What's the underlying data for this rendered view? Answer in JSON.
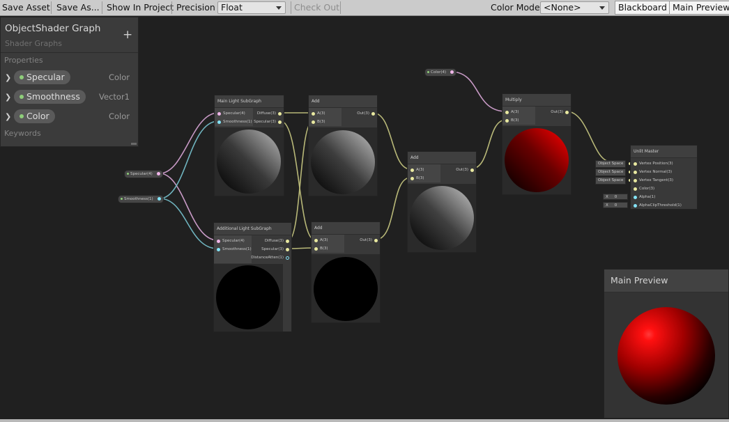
{
  "toolbar": {
    "save_asset": "Save Asset",
    "save_as": "Save As...",
    "show_in_project": "Show In Project",
    "precision_label": "Precision",
    "precision_value": "Float",
    "check_out": "Check Out",
    "color_mode_label": "Color Mode",
    "color_mode_value": "<None>",
    "blackboard": "Blackboard",
    "main_preview": "Main Preview"
  },
  "blackboard": {
    "title": "ObjectShader Graph",
    "subtitle": "Shader Graphs",
    "add_icon": "plus-icon",
    "properties_label": "Properties",
    "keywords_label": "Keywords",
    "properties": [
      {
        "name": "Specular",
        "type": "Color"
      },
      {
        "name": "Smoothness",
        "type": "Vector1"
      },
      {
        "name": "Color",
        "type": "Color"
      }
    ]
  },
  "graph": {
    "property_nodes": {
      "color": "Color(4)",
      "specular": "Specular(4)",
      "smoothness": "Smoothness(1)"
    },
    "main_light": {
      "title": "Main Light SubGraph",
      "in_specular": "Specular(4)",
      "in_smoothness": "Smoothness(1)",
      "out_diffuse": "Diffuse(3)",
      "out_specular": "Specular(3)"
    },
    "additional_light": {
      "title": "Additional Light SubGraph",
      "in_specular": "Specular(4)",
      "in_smoothness": "Smoothness(1)",
      "out_diffuse": "Diffuse(3)",
      "out_specular": "Specular(3)",
      "out_distance": "DistanceAtten(1)"
    },
    "add1": {
      "title": "Add",
      "a": "A(3)",
      "b": "B(3)",
      "out": "Out(3)"
    },
    "add2": {
      "title": "Add",
      "a": "A(3)",
      "b": "B(3)",
      "out": "Out(3)"
    },
    "add3": {
      "title": "Add",
      "a": "A(3)",
      "b": "B(3)",
      "out": "Out(3)"
    },
    "multiply": {
      "title": "Multiply",
      "a": "A(3)",
      "b": "B(3)",
      "out": "Out(3)"
    },
    "master": {
      "title": "Unlit Master",
      "ports": [
        "Vertex Position(3)",
        "Vertex Normal(3)",
        "Vertex Tangent(3)",
        "Color(3)",
        "Alpha(1)",
        "AlphaClipThreshold(1)"
      ],
      "space_tag": "Object Space",
      "x_label": "X",
      "x_value": "0"
    }
  },
  "main_preview": {
    "title": "Main Preview"
  },
  "colors": {
    "port_vec3": "#e9e9a0",
    "port_vec4": "#f0b6e9",
    "port_vec1": "#84e4f7",
    "wire_vec3": "#b8b878",
    "wire_vec4": "#c89ac6",
    "wire_vec1": "#6fb4bf",
    "property_dot": "#8fce7a"
  }
}
